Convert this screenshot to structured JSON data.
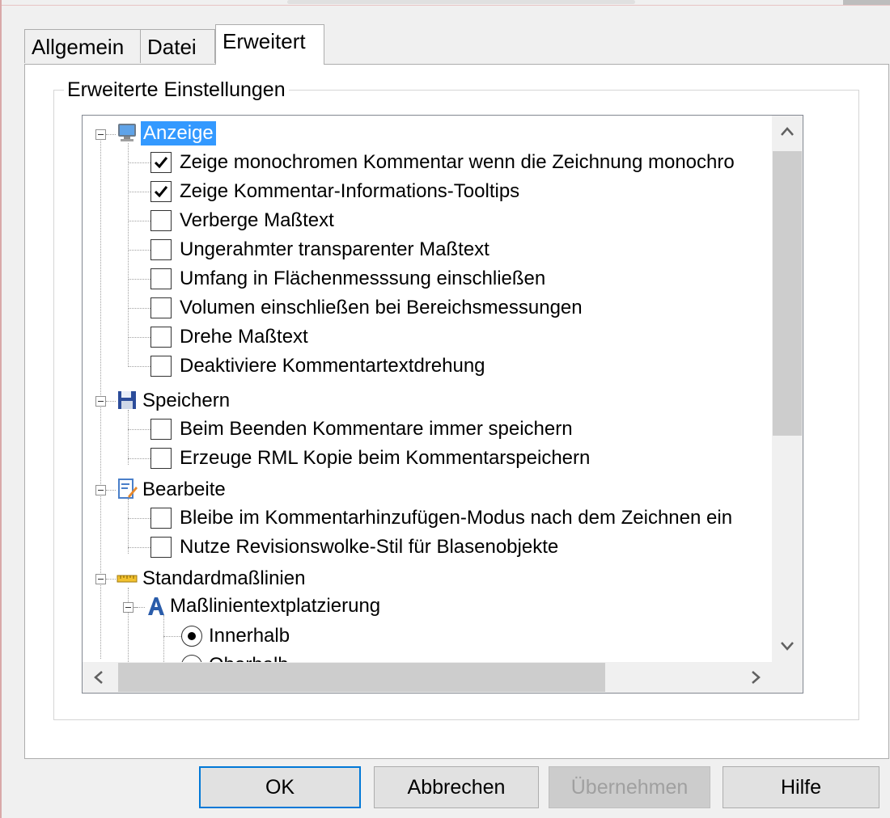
{
  "tabs": [
    "Allgemein",
    "Datei",
    "Erweitert"
  ],
  "active_tab": "Erweitert",
  "group_title": "Erweiterte Einstellungen",
  "tree": {
    "anzeige": {
      "label": "Anzeige",
      "icon": "monitor-icon",
      "items": [
        {
          "label": "Zeige monochromen Kommentar wenn die Zeichnung monochro",
          "checked": true
        },
        {
          "label": "Zeige Kommentar-Informations-Tooltips",
          "checked": true
        },
        {
          "label": "Verberge Maßtext",
          "checked": false
        },
        {
          "label": "Ungerahmter transparenter Maßtext",
          "checked": false
        },
        {
          "label": "Umfang in Flächenmesssung einschließen",
          "checked": false
        },
        {
          "label": "Volumen einschließen bei Bereichsmessungen",
          "checked": false
        },
        {
          "label": "Drehe Maßtext",
          "checked": false
        },
        {
          "label": "Deaktiviere Kommentartextdrehung",
          "checked": false
        }
      ]
    },
    "speichern": {
      "label": "Speichern",
      "icon": "floppy-disk-icon",
      "items": [
        {
          "label": "Beim Beenden Kommentare immer speichern",
          "checked": false
        },
        {
          "label": "Erzeuge RML Kopie beim Kommentarspeichern",
          "checked": false
        }
      ]
    },
    "bearbeite": {
      "label": "Bearbeite",
      "icon": "document-edit-icon",
      "items": [
        {
          "label": "Bleibe im Kommentarhinzufügen-Modus nach dem Zeichnen ein",
          "checked": false
        },
        {
          "label": "Nutze Revisionswolke-Stil für Blasenobjekte",
          "checked": false
        }
      ]
    },
    "standard": {
      "label": "Standardmaßlinien",
      "icon": "ruler-icon",
      "sub": {
        "label": "Maßlinientextplatzierung",
        "icon": "text-a-icon",
        "options": [
          {
            "label": "Innerhalb",
            "selected": true
          },
          {
            "label": "Oberhalb",
            "selected": false
          }
        ]
      }
    }
  },
  "buttons": {
    "ok": "OK",
    "cancel": "Abbrechen",
    "apply": "Übernehmen",
    "help": "Hilfe"
  },
  "colors": {
    "selection": "#3399ff",
    "default_button_border": "#0078d7"
  }
}
